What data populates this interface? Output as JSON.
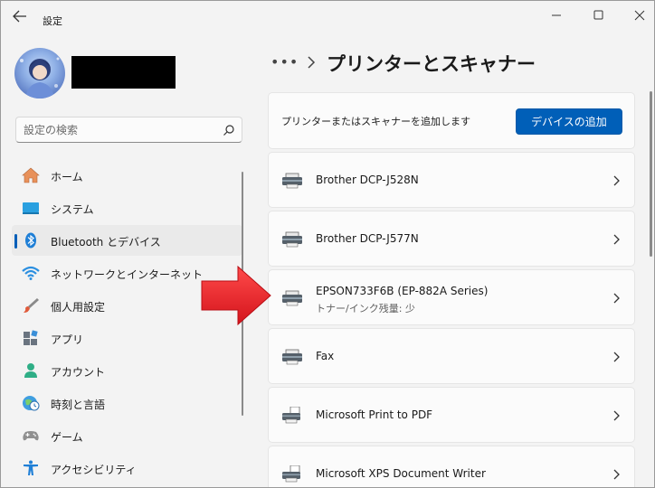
{
  "window": {
    "title": "設定"
  },
  "search": {
    "placeholder": "設定の検索"
  },
  "sidebar": {
    "items": [
      {
        "label": "ホーム",
        "icon": "home-icon"
      },
      {
        "label": "システム",
        "icon": "system-icon"
      },
      {
        "label": "Bluetooth とデバイス",
        "icon": "bluetooth-icon",
        "active": true
      },
      {
        "label": "ネットワークとインターネット",
        "icon": "wifi-icon"
      },
      {
        "label": "個人用設定",
        "icon": "brush-icon"
      },
      {
        "label": "アプリ",
        "icon": "apps-icon"
      },
      {
        "label": "アカウント",
        "icon": "account-icon"
      },
      {
        "label": "時刻と言語",
        "icon": "globe-clock-icon"
      },
      {
        "label": "ゲーム",
        "icon": "gamepad-icon"
      },
      {
        "label": "アクセシビリティ",
        "icon": "accessibility-icon"
      }
    ]
  },
  "main": {
    "breadcrumb_more": "•••",
    "title": "プリンターとスキャナー",
    "add_label": "プリンターまたはスキャナーを追加します",
    "add_button": "デバイスの追加",
    "devices": [
      {
        "name": "Brother DCP-J528N",
        "status": ""
      },
      {
        "name": "Brother DCP-J577N",
        "status": ""
      },
      {
        "name": "EPSON733F6B (EP-882A Series)",
        "status": "トナー/インク残量: 少"
      },
      {
        "name": "Fax",
        "status": ""
      },
      {
        "name": "Microsoft Print to PDF",
        "status": ""
      },
      {
        "name": "Microsoft XPS Document Writer",
        "status": ""
      }
    ]
  },
  "colors": {
    "accent": "#005fb8",
    "arrow": "#e8202a"
  }
}
